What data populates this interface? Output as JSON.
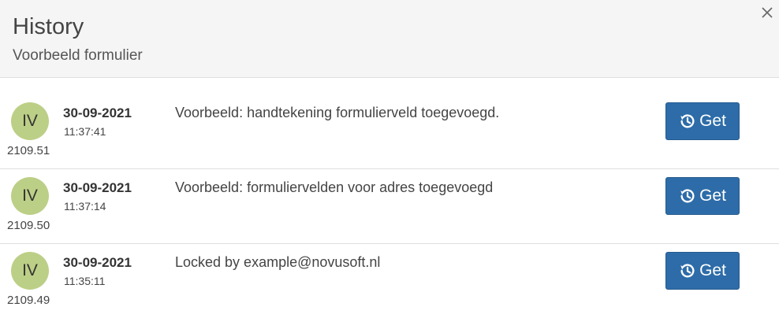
{
  "header": {
    "title": "History",
    "subtitle": "Voorbeeld formulier"
  },
  "icons": {
    "close": "close-icon",
    "history": "history-icon"
  },
  "colors": {
    "avatar_bg": "#bccf86",
    "button_bg": "#2d6ca8",
    "header_bg": "#f5f5f5"
  },
  "rows": [
    {
      "initials": "IV",
      "version": "2109.51",
      "date": "30-09-2021",
      "time": "11:37:41",
      "message": "Voorbeeld: handtekening formulierveld toegevoegd.",
      "button_label": "Get"
    },
    {
      "initials": "IV",
      "version": "2109.50",
      "date": "30-09-2021",
      "time": "11:37:14",
      "message": "Voorbeeld: formuliervelden voor adres toegevoegd",
      "button_label": "Get"
    },
    {
      "initials": "IV",
      "version": "2109.49",
      "date": "30-09-2021",
      "time": "11:35:11",
      "message": "Locked by example@novusoft.nl",
      "button_label": "Get"
    }
  ]
}
